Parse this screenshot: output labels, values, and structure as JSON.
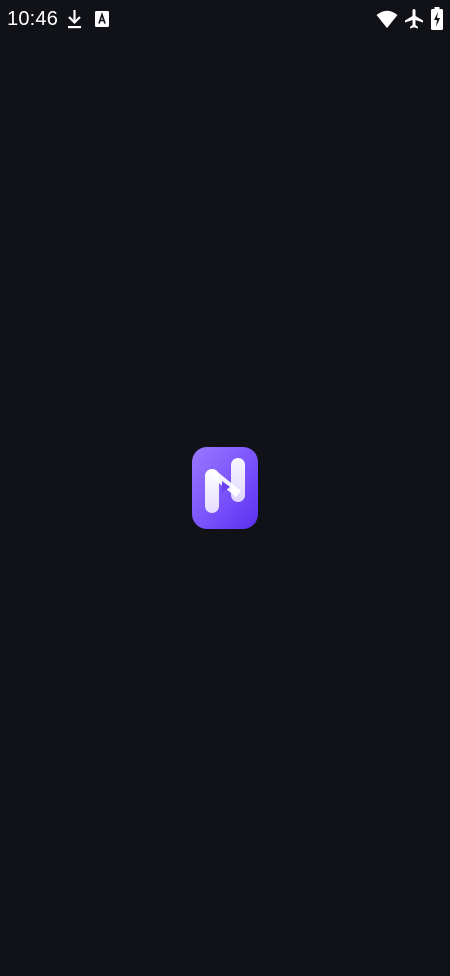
{
  "status_bar": {
    "time": "10:46",
    "icons": [
      "download-icon",
      "a-notification-icon",
      "wifi-icon",
      "airplane-mode-icon",
      "battery-charging-icon"
    ]
  },
  "splash": {
    "logo": "app-logo-n-icon"
  },
  "colors": {
    "background": "#111217",
    "logo_gradient_start": "#8f6bff",
    "logo_gradient_end": "#5b2ff0",
    "status_text": "#ffffff"
  }
}
